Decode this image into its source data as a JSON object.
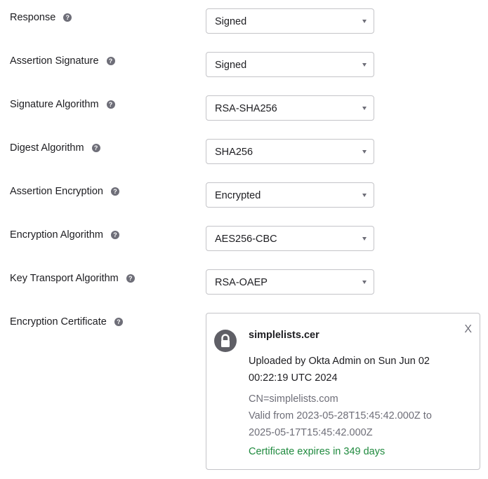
{
  "fields": [
    {
      "label": "Response",
      "value": "Signed"
    },
    {
      "label": "Assertion Signature",
      "value": "Signed"
    },
    {
      "label": "Signature Algorithm",
      "value": "RSA-SHA256"
    },
    {
      "label": "Digest Algorithm",
      "value": "SHA256"
    },
    {
      "label": "Assertion Encryption",
      "value": "Encrypted"
    },
    {
      "label": "Encryption Algorithm",
      "value": "AES256-CBC"
    },
    {
      "label": "Key Transport Algorithm",
      "value": "RSA-OAEP"
    }
  ],
  "help_glyph": "?",
  "certificate": {
    "label": "Encryption Certificate",
    "file_name": "simplelists.cer",
    "uploaded_text": "Uploaded by Okta Admin on Sun Jun 02 00:22:19 UTC 2024",
    "cn": "CN=simplelists.com",
    "valid_text": "Valid from 2023-05-28T15:45:42.000Z to 2025-05-17T15:45:42.000Z",
    "expires_text": "Certificate expires in 349 days",
    "close_label": "X",
    "icon": "lock-icon"
  },
  "colors": {
    "expires_green": "#1f8a3e",
    "muted_text": "#6e6e78",
    "border": "#c4c4c8"
  }
}
